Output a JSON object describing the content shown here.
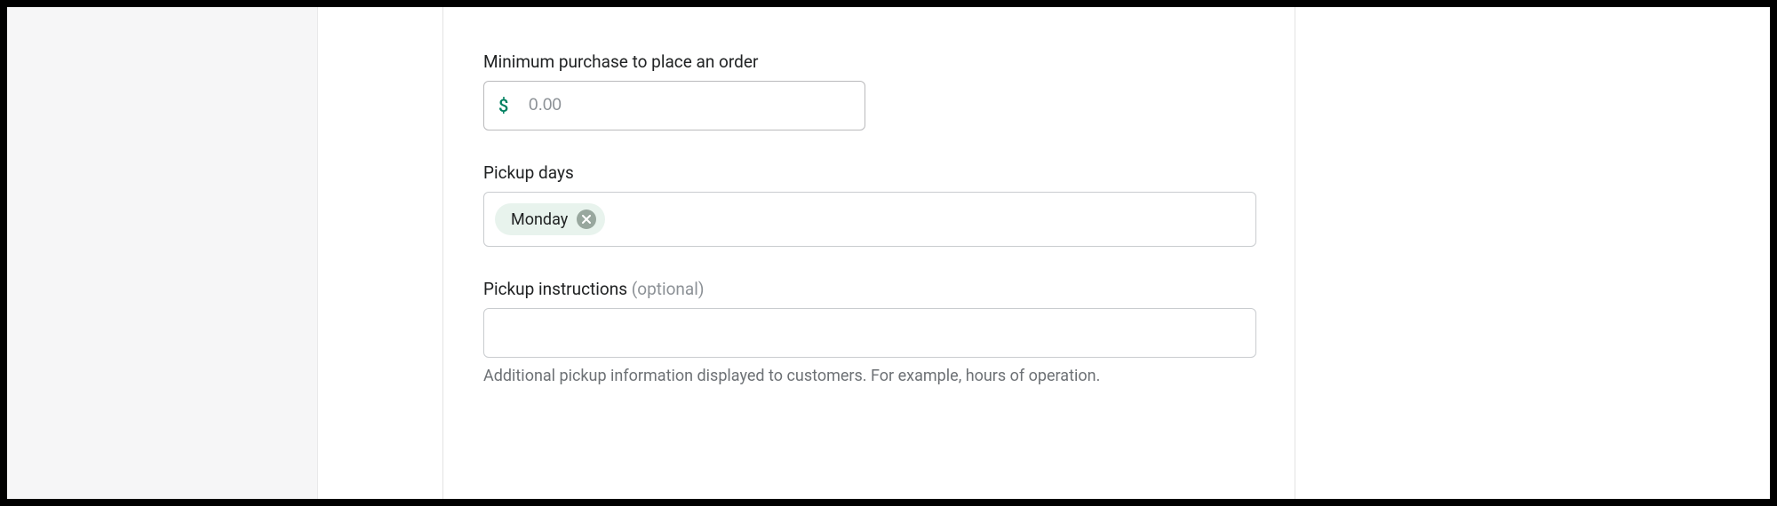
{
  "minimumPurchase": {
    "label": "Minimum purchase to place an order",
    "currencySymbol": "$",
    "placeholder": "0.00",
    "value": ""
  },
  "pickupDays": {
    "label": "Pickup days",
    "tags": [
      {
        "label": "Monday"
      }
    ]
  },
  "pickupInstructions": {
    "label": "Pickup instructions",
    "optionalText": "(optional)",
    "value": "",
    "helpText": "Additional pickup information displayed to customers. For example, hours of operation."
  }
}
